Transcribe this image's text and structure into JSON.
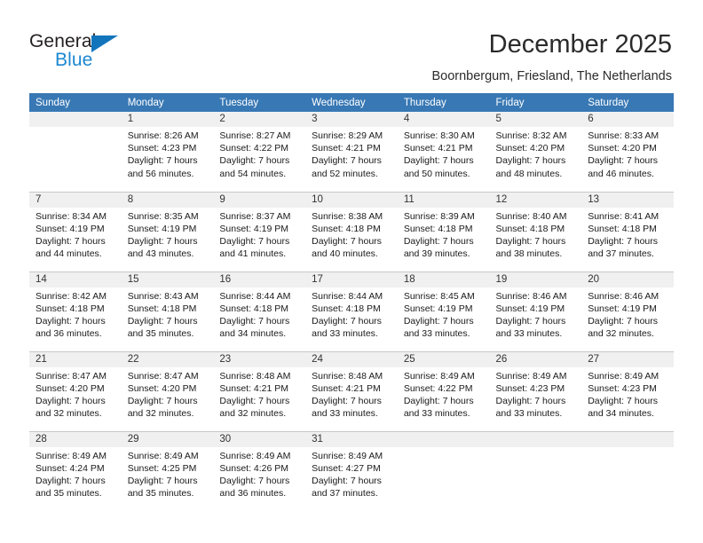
{
  "brand": {
    "name_dark": "General",
    "name_blue": "Blue",
    "accent_color": "#1275bc",
    "blue_text_color": "#1b87d2"
  },
  "header": {
    "title": "December 2025",
    "subtitle": "Boornbergum, Friesland, The Netherlands"
  },
  "calendar": {
    "header_bg": "#3878b4",
    "header_text_color": "#ffffff",
    "daynum_band_bg": "#f0f0f0",
    "grid_line_color": "#c8c8c8",
    "weekday_headers": [
      "Sunday",
      "Monday",
      "Tuesday",
      "Wednesday",
      "Thursday",
      "Friday",
      "Saturday"
    ],
    "weeks": [
      [
        {
          "day": "",
          "empty": true,
          "l1": "",
          "l2": "",
          "l3": "",
          "l4": ""
        },
        {
          "day": "1",
          "l1": "Sunrise: 8:26 AM",
          "l2": "Sunset: 4:23 PM",
          "l3": "Daylight: 7 hours",
          "l4": "and 56 minutes."
        },
        {
          "day": "2",
          "l1": "Sunrise: 8:27 AM",
          "l2": "Sunset: 4:22 PM",
          "l3": "Daylight: 7 hours",
          "l4": "and 54 minutes."
        },
        {
          "day": "3",
          "l1": "Sunrise: 8:29 AM",
          "l2": "Sunset: 4:21 PM",
          "l3": "Daylight: 7 hours",
          "l4": "and 52 minutes."
        },
        {
          "day": "4",
          "l1": "Sunrise: 8:30 AM",
          "l2": "Sunset: 4:21 PM",
          "l3": "Daylight: 7 hours",
          "l4": "and 50 minutes."
        },
        {
          "day": "5",
          "l1": "Sunrise: 8:32 AM",
          "l2": "Sunset: 4:20 PM",
          "l3": "Daylight: 7 hours",
          "l4": "and 48 minutes."
        },
        {
          "day": "6",
          "l1": "Sunrise: 8:33 AM",
          "l2": "Sunset: 4:20 PM",
          "l3": "Daylight: 7 hours",
          "l4": "and 46 minutes."
        }
      ],
      [
        {
          "day": "7",
          "l1": "Sunrise: 8:34 AM",
          "l2": "Sunset: 4:19 PM",
          "l3": "Daylight: 7 hours",
          "l4": "and 44 minutes."
        },
        {
          "day": "8",
          "l1": "Sunrise: 8:35 AM",
          "l2": "Sunset: 4:19 PM",
          "l3": "Daylight: 7 hours",
          "l4": "and 43 minutes."
        },
        {
          "day": "9",
          "l1": "Sunrise: 8:37 AM",
          "l2": "Sunset: 4:19 PM",
          "l3": "Daylight: 7 hours",
          "l4": "and 41 minutes."
        },
        {
          "day": "10",
          "l1": "Sunrise: 8:38 AM",
          "l2": "Sunset: 4:18 PM",
          "l3": "Daylight: 7 hours",
          "l4": "and 40 minutes."
        },
        {
          "day": "11",
          "l1": "Sunrise: 8:39 AM",
          "l2": "Sunset: 4:18 PM",
          "l3": "Daylight: 7 hours",
          "l4": "and 39 minutes."
        },
        {
          "day": "12",
          "l1": "Sunrise: 8:40 AM",
          "l2": "Sunset: 4:18 PM",
          "l3": "Daylight: 7 hours",
          "l4": "and 38 minutes."
        },
        {
          "day": "13",
          "l1": "Sunrise: 8:41 AM",
          "l2": "Sunset: 4:18 PM",
          "l3": "Daylight: 7 hours",
          "l4": "and 37 minutes."
        }
      ],
      [
        {
          "day": "14",
          "l1": "Sunrise: 8:42 AM",
          "l2": "Sunset: 4:18 PM",
          "l3": "Daylight: 7 hours",
          "l4": "and 36 minutes."
        },
        {
          "day": "15",
          "l1": "Sunrise: 8:43 AM",
          "l2": "Sunset: 4:18 PM",
          "l3": "Daylight: 7 hours",
          "l4": "and 35 minutes."
        },
        {
          "day": "16",
          "l1": "Sunrise: 8:44 AM",
          "l2": "Sunset: 4:18 PM",
          "l3": "Daylight: 7 hours",
          "l4": "and 34 minutes."
        },
        {
          "day": "17",
          "l1": "Sunrise: 8:44 AM",
          "l2": "Sunset: 4:18 PM",
          "l3": "Daylight: 7 hours",
          "l4": "and 33 minutes."
        },
        {
          "day": "18",
          "l1": "Sunrise: 8:45 AM",
          "l2": "Sunset: 4:19 PM",
          "l3": "Daylight: 7 hours",
          "l4": "and 33 minutes."
        },
        {
          "day": "19",
          "l1": "Sunrise: 8:46 AM",
          "l2": "Sunset: 4:19 PM",
          "l3": "Daylight: 7 hours",
          "l4": "and 33 minutes."
        },
        {
          "day": "20",
          "l1": "Sunrise: 8:46 AM",
          "l2": "Sunset: 4:19 PM",
          "l3": "Daylight: 7 hours",
          "l4": "and 32 minutes."
        }
      ],
      [
        {
          "day": "21",
          "l1": "Sunrise: 8:47 AM",
          "l2": "Sunset: 4:20 PM",
          "l3": "Daylight: 7 hours",
          "l4": "and 32 minutes."
        },
        {
          "day": "22",
          "l1": "Sunrise: 8:47 AM",
          "l2": "Sunset: 4:20 PM",
          "l3": "Daylight: 7 hours",
          "l4": "and 32 minutes."
        },
        {
          "day": "23",
          "l1": "Sunrise: 8:48 AM",
          "l2": "Sunset: 4:21 PM",
          "l3": "Daylight: 7 hours",
          "l4": "and 32 minutes."
        },
        {
          "day": "24",
          "l1": "Sunrise: 8:48 AM",
          "l2": "Sunset: 4:21 PM",
          "l3": "Daylight: 7 hours",
          "l4": "and 33 minutes."
        },
        {
          "day": "25",
          "l1": "Sunrise: 8:49 AM",
          "l2": "Sunset: 4:22 PM",
          "l3": "Daylight: 7 hours",
          "l4": "and 33 minutes."
        },
        {
          "day": "26",
          "l1": "Sunrise: 8:49 AM",
          "l2": "Sunset: 4:23 PM",
          "l3": "Daylight: 7 hours",
          "l4": "and 33 minutes."
        },
        {
          "day": "27",
          "l1": "Sunrise: 8:49 AM",
          "l2": "Sunset: 4:23 PM",
          "l3": "Daylight: 7 hours",
          "l4": "and 34 minutes."
        }
      ],
      [
        {
          "day": "28",
          "l1": "Sunrise: 8:49 AM",
          "l2": "Sunset: 4:24 PM",
          "l3": "Daylight: 7 hours",
          "l4": "and 35 minutes."
        },
        {
          "day": "29",
          "l1": "Sunrise: 8:49 AM",
          "l2": "Sunset: 4:25 PM",
          "l3": "Daylight: 7 hours",
          "l4": "and 35 minutes."
        },
        {
          "day": "30",
          "l1": "Sunrise: 8:49 AM",
          "l2": "Sunset: 4:26 PM",
          "l3": "Daylight: 7 hours",
          "l4": "and 36 minutes."
        },
        {
          "day": "31",
          "l1": "Sunrise: 8:49 AM",
          "l2": "Sunset: 4:27 PM",
          "l3": "Daylight: 7 hours",
          "l4": "and 37 minutes."
        },
        {
          "day": "",
          "empty": true,
          "l1": "",
          "l2": "",
          "l3": "",
          "l4": ""
        },
        {
          "day": "",
          "empty": true,
          "l1": "",
          "l2": "",
          "l3": "",
          "l4": ""
        },
        {
          "day": "",
          "empty": true,
          "l1": "",
          "l2": "",
          "l3": "",
          "l4": ""
        }
      ]
    ]
  }
}
